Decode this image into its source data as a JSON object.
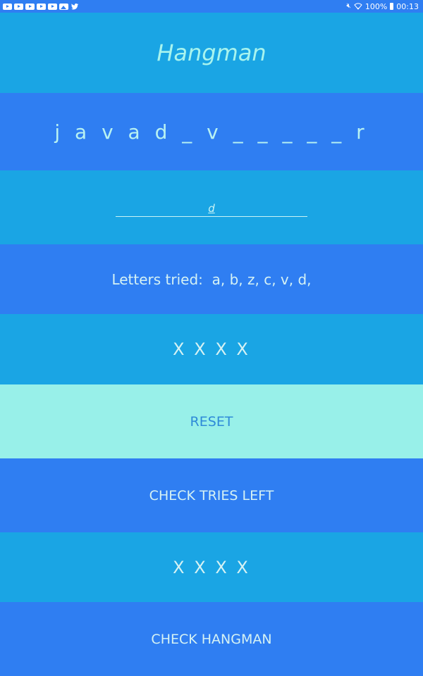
{
  "status_bar": {
    "notification_icons": [
      "youtube-icon",
      "youtube-icon",
      "youtube-icon",
      "youtube-icon",
      "youtube-icon",
      "image-icon",
      "twitter-icon"
    ],
    "battery": "100%",
    "time": "00:13"
  },
  "app": {
    "title": "Hangman"
  },
  "game": {
    "word_display": "j a v a d _ v _ _ _ _ _ r",
    "letter_input_value": "d",
    "letters_tried": "Letters tried:  a, b, z, c, v, d,",
    "tries_marks_top": "X X X X",
    "tries_marks_bottom": "X X X X"
  },
  "buttons": {
    "reset": "RESET",
    "check_tries_left": "CHECK TRIES LEFT",
    "check_hangman": "CHECK HANGMAN"
  },
  "colors": {
    "light_band": "#1aa5e4",
    "dark_band": "#2f7ef2",
    "reset_band": "#98f0e9",
    "title_text": "#a8f4ee"
  }
}
